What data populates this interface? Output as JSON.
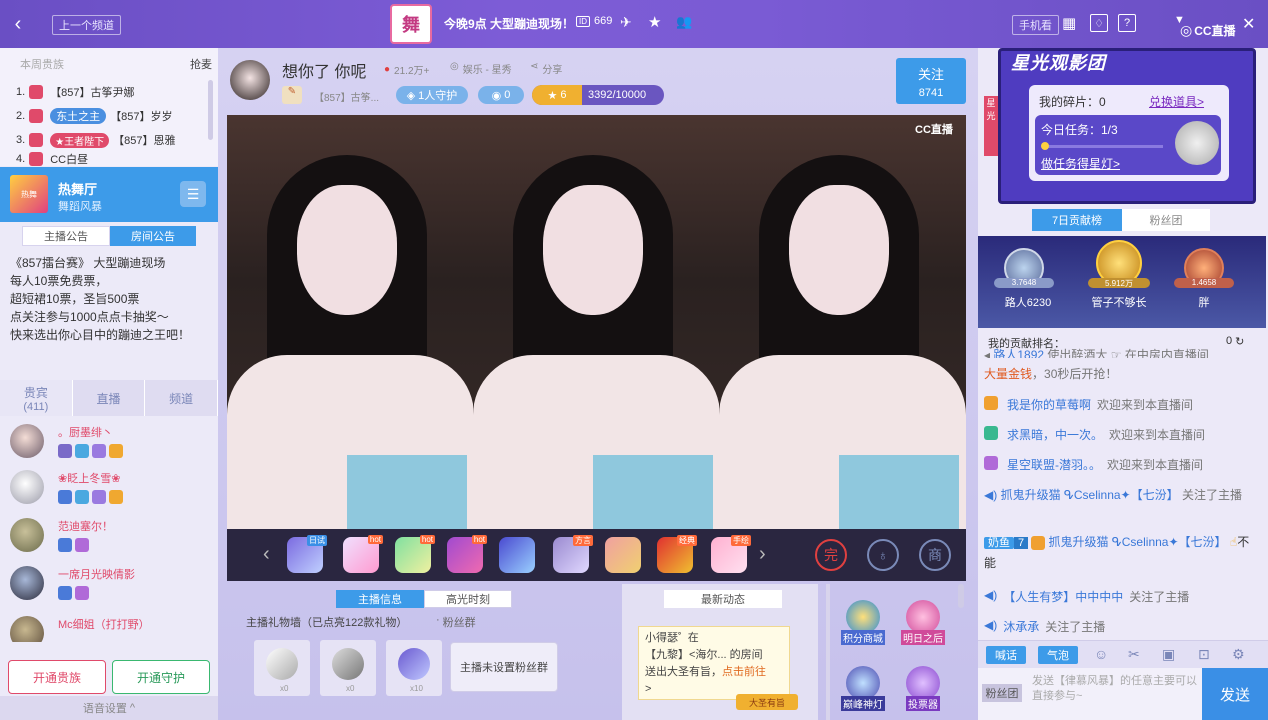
{
  "topbar": {
    "back_label": "<",
    "prev_channel": "上一个频道",
    "event_title": "今晚9点 大型蹦迪现场！",
    "viewer_count": "669",
    "mobile_watch": "手机看",
    "cc_logo": "CC直播"
  },
  "ranking": {
    "header_left": "本周贵族",
    "header_right": "抢麦",
    "items": [
      {
        "num": "1.",
        "badge": "",
        "text": "【857】古筝尹娜"
      },
      {
        "num": "2.",
        "badge": "东土之主",
        "text": "【857】岁岁"
      },
      {
        "num": "3.",
        "badge": "★王者陛下",
        "text": "【857】恩雅"
      },
      {
        "num": "4.",
        "badge": "",
        "text": "CC白昼"
      }
    ]
  },
  "hotband": {
    "title": "热舞厅",
    "subtitle": "舞蹈风暴"
  },
  "notice": {
    "tab_anchor": "主播公告",
    "tab_room": "房间公告",
    "lines": [
      "《857擂台赛》 大型蹦迪现场",
      "每人10票免费票，",
      "超短裙10票，圣旨500票",
      "点关注参与1000点点卡抽奖～",
      "快来选出你心目中的蹦迪之王吧！"
    ]
  },
  "userlist": {
    "tab_noble": "贵宾",
    "tab_noble_count": "(411)",
    "tab_live": "直播",
    "tab_channel": "频道",
    "users": [
      {
        "name": "。厨墨绯丶",
        "color": "#e04a6a"
      },
      {
        "name": "❀眨上冬雪❀",
        "color": "#e04a6a"
      },
      {
        "name": "范迪塞尔！",
        "color": "#e04a6a"
      },
      {
        "name": "一席月光映倩影",
        "color": "#e04a6a"
      },
      {
        "name": "Mc细姐（打打野）",
        "color": "#e04a6a"
      }
    ]
  },
  "bottom_left": {
    "open_noble": "开通贵族",
    "open_guard": "开通守护",
    "voice_settings": "语音设置"
  },
  "anchor": {
    "name": "想你了 你呢",
    "heat": "21.2万+",
    "category": "娱乐 - 星秀",
    "share": "分享",
    "room": "【857】古筝...",
    "guard": "1人守护",
    "fans": "0",
    "level": "6",
    "exp": "3392/10000",
    "follow": "关注",
    "follow_count": "8741"
  },
  "video": {
    "watermark": "CC直播"
  },
  "gifts": {
    "tags": [
      "日试",
      "hot",
      "hot",
      "hot",
      "",
      "方言",
      "",
      "经典",
      "手绘"
    ],
    "complete": "完",
    "shop": "商"
  },
  "lower": {
    "tab_info": "主播信息",
    "tab_highlight": "高光时刻",
    "gift_wall": "主播礼物墙（已点亮122款礼物）",
    "fan_group": "粉丝群",
    "no_fan_group": "主播未设置粉丝群",
    "gift_counts": [
      "x0",
      "x0",
      "x10"
    ],
    "news_title": "最新动态",
    "news_user": "小得瑟˚",
    "news_in": "在",
    "news_room": "【九黎】<海尔...",
    "news_room_suffix": "的房间",
    "news_text": "送出大圣有旨，",
    "news_link": "点击前往",
    "news_arrow": ">",
    "news_badge": "大圣有旨",
    "buttons": [
      "积分商城",
      "明日之后",
      "巅峰神灯",
      "投票器"
    ]
  },
  "starpromo": {
    "title": "星光观影团",
    "fragments": "我的碎片：0",
    "exchange": "兑换道具>",
    "task": "今日任务：1/3",
    "do_task": "做任务得星灯>"
  },
  "podium": {
    "tab_7day": "7日贡献榜",
    "tab_fans": "粉丝团",
    "left_name": "路人6230",
    "center_name": "管子不够长",
    "right_name": "胖",
    "left_score": "3.7648",
    "center_score": "5.912万",
    "right_score": "1.4658",
    "my_rank": "我的贡献排名：",
    "my_score": "0"
  },
  "chat": {
    "lines": [
      {
        "name": "路人1892",
        "text": "使出醉酒大 ☞ 在中房内直播间",
        "color": "#3a78d8"
      },
      {
        "name": "大量金钱",
        "text": "，30秒后开抢！",
        "color": "#e05a20"
      },
      {
        "name": "我是你的草莓啊",
        "text": "欢迎来到本直播间",
        "color": "#3a78d8"
      },
      {
        "name": "求黑暗，中一次。",
        "text": "欢迎来到本直播间",
        "color": "#3a78d8"
      },
      {
        "name": "星空联盟-潜羽。。",
        "text": "欢迎来到本直播间",
        "color": "#3a78d8"
      },
      {
        "name": "抓鬼升级猫 ᕴCselinna✦【七汾】",
        "text": "关注了主播",
        "color": "#3a78d8"
      },
      {
        "name": "抓鬼升级猫 ᕴCselinna✦【七汾】",
        "text": "不能",
        "color": "#3a78d8"
      },
      {
        "name": "【人生有梦】中中中中",
        "text": "关注了主播",
        "color": "#3a78d8"
      },
      {
        "name": "沐承承",
        "text": "关注了主播",
        "color": "#3a78d8"
      }
    ],
    "level_badge": "奶鱼",
    "level_num": "7",
    "btn_shout": "喊话",
    "btn_bubble": "气泡",
    "fan_btn": "粉丝团",
    "input_placeholder": "发送【律慕风暴】的任意主要可以直接参与~",
    "send": "发送"
  }
}
